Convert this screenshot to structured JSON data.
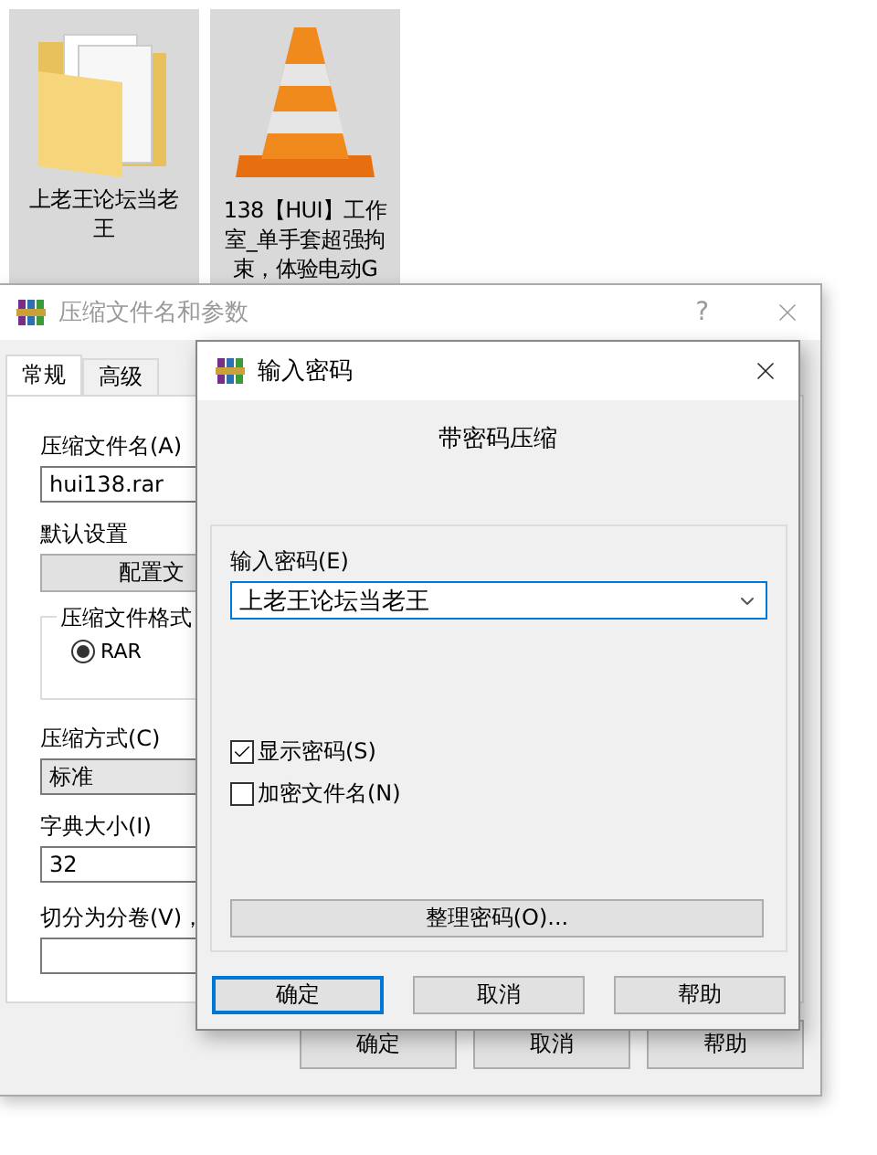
{
  "desktop_icons": [
    {
      "kind": "folder",
      "label": "上老王论坛当老王",
      "selected": true
    },
    {
      "kind": "cone",
      "label": "138【HUI】工作室_单手套超强拘束，体验电动G",
      "selected": true
    }
  ],
  "archive_window": {
    "title": "压缩文件名和参数",
    "help_glyph": "?",
    "tabs": [
      {
        "label": "常规",
        "selected": true
      },
      {
        "label": "高级",
        "selected": false
      }
    ],
    "name_label": "压缩文件名(A)",
    "name_value": "hui138.rar",
    "defaults_label": "默认设置",
    "profiles_button": "配置文",
    "format_group": "压缩文件格式",
    "format_options": [
      {
        "label": "RAR",
        "selected": true
      }
    ],
    "method_label": "压缩方式(C)",
    "method_value": "标准",
    "dictionary_label": "字典大小(I)",
    "dictionary_value": "32",
    "split_label": "切分为分卷(V)，",
    "buttons": [
      "确定",
      "取消",
      "帮助"
    ]
  },
  "password_dialog": {
    "title": "输入密码",
    "heading": "带密码压缩",
    "password_label": "输入密码(E)",
    "password_value": "上老王论坛当老王",
    "checkboxes": [
      {
        "label": "显示密码(S)",
        "checked": true
      },
      {
        "label": "加密文件名(N)",
        "checked": false
      }
    ],
    "organize_button": "整理密码(O)...",
    "buttons": [
      {
        "label": "确定",
        "default": true
      },
      {
        "label": "取消",
        "default": false
      },
      {
        "label": "帮助",
        "default": false
      }
    ]
  }
}
